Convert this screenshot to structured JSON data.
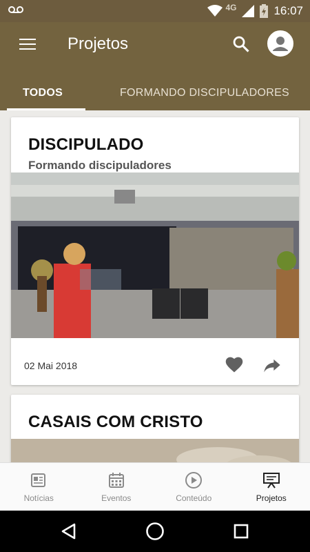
{
  "status_bar": {
    "network": "4G",
    "time": "16:07"
  },
  "app_bar": {
    "title": "Projetos"
  },
  "tabs": [
    {
      "label": "TODOS",
      "active": true
    },
    {
      "label": "FORMANDO DISCIPULADORES",
      "active": false
    }
  ],
  "cards": [
    {
      "title": "DISCIPULADO",
      "subtitle": "Formando discipuladores",
      "date": "02 Mai 2018",
      "image": "auditorium-graduation-photo"
    },
    {
      "title": "CASAIS COM CRISTO",
      "image": "sky-clouds-photo"
    }
  ],
  "bottom_nav": [
    {
      "label": "Notícias",
      "icon": "news-icon"
    },
    {
      "label": "Eventos",
      "icon": "calendar-icon"
    },
    {
      "label": "Conteúdo",
      "icon": "play-icon"
    },
    {
      "label": "Projetos",
      "icon": "presentation-icon",
      "active": true
    }
  ],
  "colors": {
    "app_bar": "#73633f",
    "status_bar": "#6d5c3e",
    "background": "#ecebe8"
  }
}
